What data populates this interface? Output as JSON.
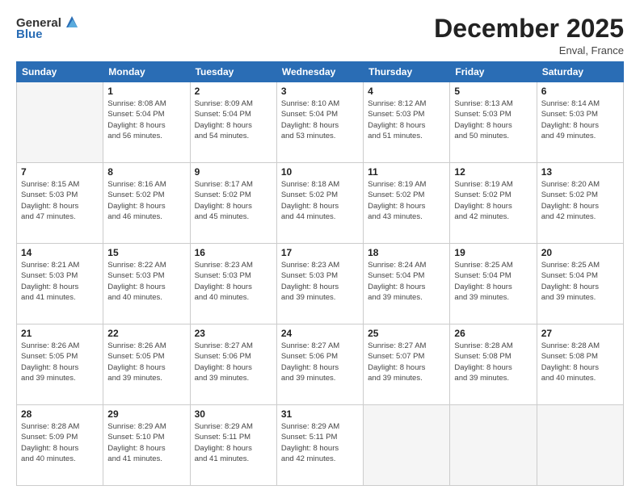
{
  "logo": {
    "general": "General",
    "blue": "Blue"
  },
  "title": "December 2025",
  "location": "Enval, France",
  "days_header": [
    "Sunday",
    "Monday",
    "Tuesday",
    "Wednesday",
    "Thursday",
    "Friday",
    "Saturday"
  ],
  "weeks": [
    [
      {
        "day": "",
        "detail": ""
      },
      {
        "day": "1",
        "detail": "Sunrise: 8:08 AM\nSunset: 5:04 PM\nDaylight: 8 hours\nand 56 minutes."
      },
      {
        "day": "2",
        "detail": "Sunrise: 8:09 AM\nSunset: 5:04 PM\nDaylight: 8 hours\nand 54 minutes."
      },
      {
        "day": "3",
        "detail": "Sunrise: 8:10 AM\nSunset: 5:04 PM\nDaylight: 8 hours\nand 53 minutes."
      },
      {
        "day": "4",
        "detail": "Sunrise: 8:12 AM\nSunset: 5:03 PM\nDaylight: 8 hours\nand 51 minutes."
      },
      {
        "day": "5",
        "detail": "Sunrise: 8:13 AM\nSunset: 5:03 PM\nDaylight: 8 hours\nand 50 minutes."
      },
      {
        "day": "6",
        "detail": "Sunrise: 8:14 AM\nSunset: 5:03 PM\nDaylight: 8 hours\nand 49 minutes."
      }
    ],
    [
      {
        "day": "7",
        "detail": "Sunrise: 8:15 AM\nSunset: 5:03 PM\nDaylight: 8 hours\nand 47 minutes."
      },
      {
        "day": "8",
        "detail": "Sunrise: 8:16 AM\nSunset: 5:02 PM\nDaylight: 8 hours\nand 46 minutes."
      },
      {
        "day": "9",
        "detail": "Sunrise: 8:17 AM\nSunset: 5:02 PM\nDaylight: 8 hours\nand 45 minutes."
      },
      {
        "day": "10",
        "detail": "Sunrise: 8:18 AM\nSunset: 5:02 PM\nDaylight: 8 hours\nand 44 minutes."
      },
      {
        "day": "11",
        "detail": "Sunrise: 8:19 AM\nSunset: 5:02 PM\nDaylight: 8 hours\nand 43 minutes."
      },
      {
        "day": "12",
        "detail": "Sunrise: 8:19 AM\nSunset: 5:02 PM\nDaylight: 8 hours\nand 42 minutes."
      },
      {
        "day": "13",
        "detail": "Sunrise: 8:20 AM\nSunset: 5:02 PM\nDaylight: 8 hours\nand 42 minutes."
      }
    ],
    [
      {
        "day": "14",
        "detail": "Sunrise: 8:21 AM\nSunset: 5:03 PM\nDaylight: 8 hours\nand 41 minutes."
      },
      {
        "day": "15",
        "detail": "Sunrise: 8:22 AM\nSunset: 5:03 PM\nDaylight: 8 hours\nand 40 minutes."
      },
      {
        "day": "16",
        "detail": "Sunrise: 8:23 AM\nSunset: 5:03 PM\nDaylight: 8 hours\nand 40 minutes."
      },
      {
        "day": "17",
        "detail": "Sunrise: 8:23 AM\nSunset: 5:03 PM\nDaylight: 8 hours\nand 39 minutes."
      },
      {
        "day": "18",
        "detail": "Sunrise: 8:24 AM\nSunset: 5:04 PM\nDaylight: 8 hours\nand 39 minutes."
      },
      {
        "day": "19",
        "detail": "Sunrise: 8:25 AM\nSunset: 5:04 PM\nDaylight: 8 hours\nand 39 minutes."
      },
      {
        "day": "20",
        "detail": "Sunrise: 8:25 AM\nSunset: 5:04 PM\nDaylight: 8 hours\nand 39 minutes."
      }
    ],
    [
      {
        "day": "21",
        "detail": "Sunrise: 8:26 AM\nSunset: 5:05 PM\nDaylight: 8 hours\nand 39 minutes."
      },
      {
        "day": "22",
        "detail": "Sunrise: 8:26 AM\nSunset: 5:05 PM\nDaylight: 8 hours\nand 39 minutes."
      },
      {
        "day": "23",
        "detail": "Sunrise: 8:27 AM\nSunset: 5:06 PM\nDaylight: 8 hours\nand 39 minutes."
      },
      {
        "day": "24",
        "detail": "Sunrise: 8:27 AM\nSunset: 5:06 PM\nDaylight: 8 hours\nand 39 minutes."
      },
      {
        "day": "25",
        "detail": "Sunrise: 8:27 AM\nSunset: 5:07 PM\nDaylight: 8 hours\nand 39 minutes."
      },
      {
        "day": "26",
        "detail": "Sunrise: 8:28 AM\nSunset: 5:08 PM\nDaylight: 8 hours\nand 39 minutes."
      },
      {
        "day": "27",
        "detail": "Sunrise: 8:28 AM\nSunset: 5:08 PM\nDaylight: 8 hours\nand 40 minutes."
      }
    ],
    [
      {
        "day": "28",
        "detail": "Sunrise: 8:28 AM\nSunset: 5:09 PM\nDaylight: 8 hours\nand 40 minutes."
      },
      {
        "day": "29",
        "detail": "Sunrise: 8:29 AM\nSunset: 5:10 PM\nDaylight: 8 hours\nand 41 minutes."
      },
      {
        "day": "30",
        "detail": "Sunrise: 8:29 AM\nSunset: 5:11 PM\nDaylight: 8 hours\nand 41 minutes."
      },
      {
        "day": "31",
        "detail": "Sunrise: 8:29 AM\nSunset: 5:11 PM\nDaylight: 8 hours\nand 42 minutes."
      },
      {
        "day": "",
        "detail": ""
      },
      {
        "day": "",
        "detail": ""
      },
      {
        "day": "",
        "detail": ""
      }
    ]
  ]
}
